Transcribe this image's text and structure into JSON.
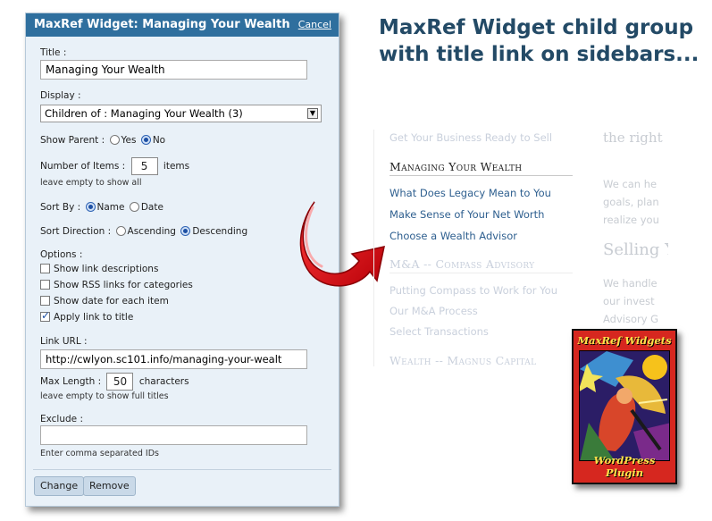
{
  "widget": {
    "header_title": "MaxRef Widget: Managing Your Wealth",
    "cancel_label": "Cancel",
    "title_label": "Title :",
    "title_value": "Managing Your Wealth",
    "display_label": "Display :",
    "display_value": "Children of : Managing Your Wealth (3)",
    "show_parent_label": "Show Parent :",
    "show_parent_yes": "Yes",
    "show_parent_no": "No",
    "show_parent_selected": "No",
    "num_items_label": "Number of Items :",
    "num_items_value": "5",
    "num_items_suffix": "items",
    "num_items_hint": "leave empty to show all",
    "sort_by_label": "Sort By :",
    "sort_by_name": "Name",
    "sort_by_date": "Date",
    "sort_by_selected": "Name",
    "sort_dir_label": "Sort Direction :",
    "sort_dir_asc": "Ascending",
    "sort_dir_desc": "Descending",
    "sort_dir_selected": "Descending",
    "options_label": "Options :",
    "options": [
      {
        "label": "Show link descriptions",
        "checked": false
      },
      {
        "label": "Show RSS links for categories",
        "checked": false
      },
      {
        "label": "Show date for each item",
        "checked": false
      },
      {
        "label": "Apply link to title",
        "checked": true
      }
    ],
    "link_url_label": "Link URL :",
    "link_url_value": "http://cwlyon.sc101.info/managing-your-wealt",
    "max_length_label": "Max Length :",
    "max_length_value": "50",
    "max_length_suffix": "characters",
    "max_length_hint": "leave empty to show full titles",
    "exclude_label": "Exclude :",
    "exclude_value": "",
    "exclude_hint": "Enter comma separated IDs",
    "change_label": "Change",
    "remove_label": "Remove"
  },
  "headline": "MaxRef Widget child group with title link on sidebars...",
  "sidebar": {
    "top_faded": "Get Your Business Ready to Sell",
    "group1_title": "Managing Your Wealth",
    "group1_items": [
      "What Does Legacy Mean to You",
      "Make Sense of Your Net Worth",
      "Choose a Wealth Advisor"
    ],
    "group2_title": "M&A -- Compass Advisory",
    "group2_items": [
      "Putting Compass to Work for You",
      "Our M&A Process",
      "Select Transactions"
    ],
    "group3_title": "Wealth -- Magnus Capital"
  },
  "background_text": {
    "top": "the right",
    "lines1": [
      "We can he",
      "goals, plan",
      "realize you"
    ],
    "heading": "Selling Y",
    "lines2": [
      "We handle",
      "our invest",
      "Advisory G"
    ]
  },
  "badge": {
    "top_text": "MaxRef Widgets",
    "bottom_text": "WordPress Plugin"
  },
  "colors": {
    "header_bg": "#2f6f9e",
    "panel_bg": "#e9f1f8",
    "headline": "#234a66",
    "arrow_red": "#e0141c",
    "badge_red": "#d6271f",
    "badge_yellow": "#ffe14a"
  }
}
